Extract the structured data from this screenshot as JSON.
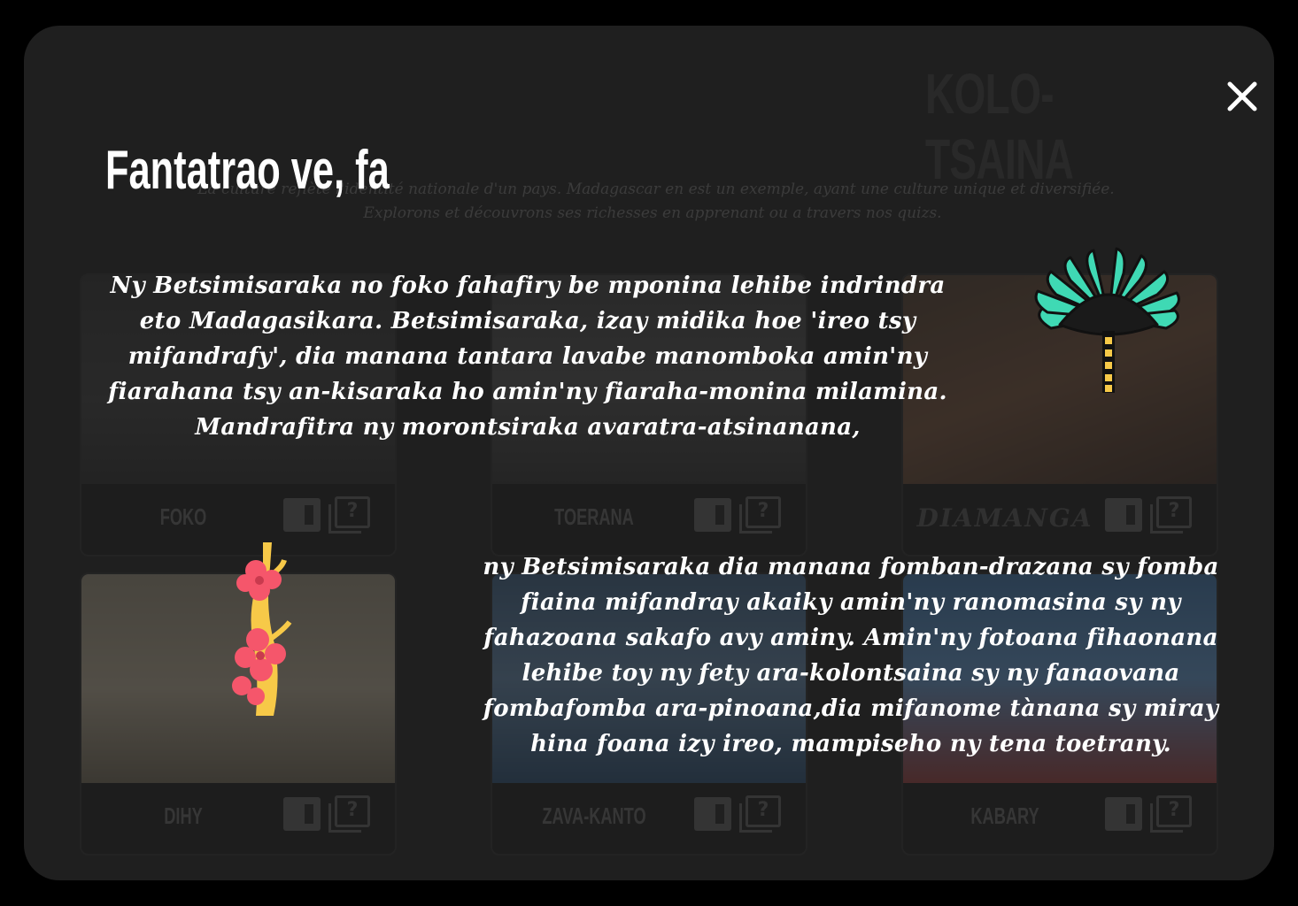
{
  "background": {
    "section_title": "KOLO-TSAINA",
    "quote_line1": "\"La culture reflète l'identité nationale d'un pays. Madagascar en est un exemple, ayant une culture unique et diversifiée.",
    "quote_line2": "Explorons et découvrons ses richesses en apprenant ou a travers nos quizs.",
    "cards": [
      {
        "label": "FOKO"
      },
      {
        "label": "TOERANA"
      },
      {
        "label": "DIAMANGA"
      },
      {
        "label": "DIHY"
      },
      {
        "label": "ZAVA-KANTO"
      },
      {
        "label": "KABARY"
      }
    ]
  },
  "modal": {
    "title": "Fantatrao ve, fa",
    "paragraph1": "Ny Betsimisaraka no foko fahafiry be mponina lehibe indrindra eto Madagasikara. Betsimisaraka, izay midika hoe 'ireo tsy mifandrafy', dia manana tantara lavabe manomboka amin'ny fiarahana tsy an-kisaraka ho amin'ny fiaraha-monina milamina. Mandrafitra ny morontsiraka avaratra-atsinanana,",
    "paragraph2": "ny Betsimisaraka dia manana fomban-drazana sy fomba fiaina mifandray akaiky amin'ny ranomasina sy ny fahazoana sakafo avy aminy. Amin'ny fotoana fihaonana lehibe toy ny fety ara-kolontsaina sy ny fanaovana fombafomba ara-pinoana,dia mifanome tànana sy miray hina foana izy ireo, mampiseho ny tena toetrany."
  },
  "icons": [
    "close-icon",
    "traveller-palm-icon",
    "flower-branch-icon",
    "book-icon",
    "quiz-icon"
  ],
  "colors": {
    "panel": "#1f1f1f",
    "palm": "#3fd9b4",
    "flower": "#f5566b",
    "branch": "#f7c948"
  }
}
